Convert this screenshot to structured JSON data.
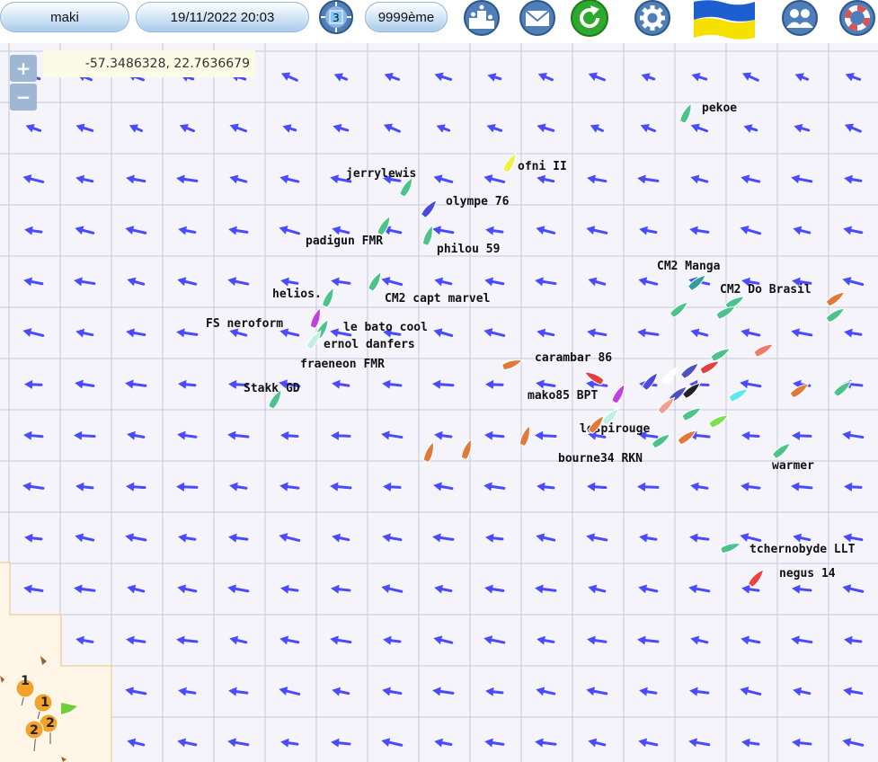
{
  "toolbar": {
    "user": "maki",
    "datetime": "19/11/2022 20:03",
    "notification_count": "3",
    "rank": "9999ème"
  },
  "map": {
    "coordinates": "-57.3486328, 22.7636679",
    "zoom_in": "+",
    "zoom_out": "−",
    "markers": [
      "1",
      "1",
      "2",
      "2"
    ],
    "boats": [
      "pekoe",
      "ofni II",
      "jerrylewis",
      "olympe 76",
      "padigun FMR",
      "philou 59",
      "CM2 Manga",
      "CM2 Do Brasil",
      "helios.",
      "CM2 capt marvel",
      "FS neroform",
      "le bato cool",
      "ernol danfers",
      "fraeneon FMR",
      "Stakk GD",
      "carambar 86",
      "mako85 BPT",
      "lespirouge",
      "bourne34 RKN",
      "warmer",
      "tchernobyde LLT",
      "negus 14"
    ]
  },
  "colors": {
    "wind_arrow": "#4a4aff",
    "grid": "#c8c8dc",
    "flag_top": "#1d5fd0",
    "flag_bottom": "#f6e000"
  }
}
